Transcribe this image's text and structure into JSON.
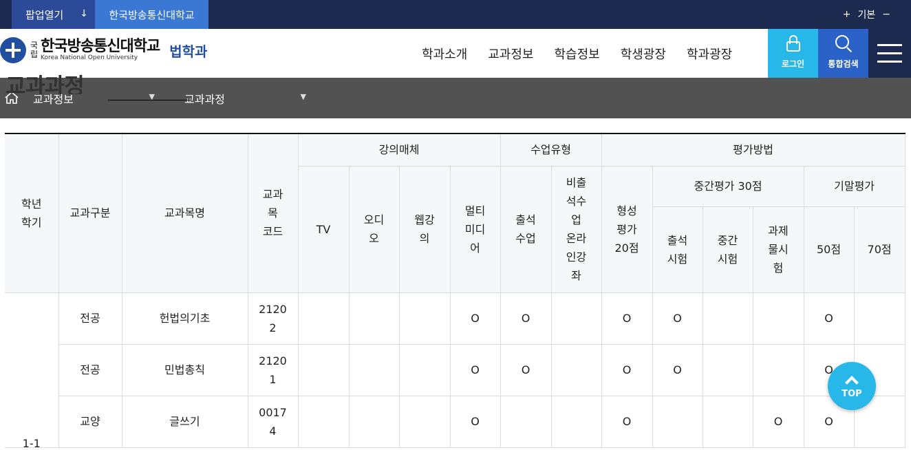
{
  "topbar": {
    "popup_label": "팝업열기",
    "popup_arrow": "↓",
    "univ_label": "한국방송통신대학교",
    "font_plus": "+",
    "font_label": "기본",
    "font_minus": "−"
  },
  "logo": {
    "national_top": "국",
    "national_bottom": "립",
    "name_kr": "한국방송통신대학교",
    "name_en": "Korea National Open University",
    "dept": "법학과"
  },
  "nav": {
    "items": [
      "학과소개",
      "교과정보",
      "학습정보",
      "학생광장",
      "학과광장"
    ]
  },
  "header_buttons": {
    "login": "로그인",
    "search": "통합검색"
  },
  "page_title": "교과과정",
  "breadcrumb": {
    "level1": "교과정보",
    "level2": "교과과정",
    "caret": "▼"
  },
  "table": {
    "headers": {
      "year_term": "학년\n학기",
      "category": "교과구분",
      "course_name": "교과목명",
      "course_code": "교과\n목\n코드",
      "media": "강의매체",
      "class_type": "수업유형",
      "evaluation": "평가방법",
      "tv": "TV",
      "audio": "오디\n오",
      "web": "웹강\n의",
      "multimedia": "멀티\n미디\n어",
      "attend_class": "출석\n수업",
      "online_lecture": "비출\n석수\n업\n온라\n인강\n좌",
      "formative": "형성\n평가\n20점",
      "midterm": "중간평가 30점",
      "final": "기말평가",
      "attend_exam": "출석\n시험",
      "mid_exam": "중간\n시험",
      "assignment": "과제\n물시\n험",
      "final_50": "50점",
      "final_70": "70점"
    },
    "year_term_value": "1-1",
    "rows": [
      {
        "category": "전공",
        "name": "헌법의기초",
        "code": "2120\n2",
        "tv": "",
        "audio": "",
        "web": "",
        "multi": "O",
        "attend": "O",
        "online": "",
        "formative": "O",
        "att_exam": "O",
        "mid_exam": "",
        "assign": "",
        "f50": "O",
        "f70": ""
      },
      {
        "category": "전공",
        "name": "민법총칙",
        "code": "2120\n1",
        "tv": "",
        "audio": "",
        "web": "",
        "multi": "O",
        "attend": "O",
        "online": "",
        "formative": "O",
        "att_exam": "O",
        "mid_exam": "",
        "assign": "",
        "f50": "O",
        "f70": ""
      },
      {
        "category": "교양",
        "name": "글쓰기",
        "code": "0017\n4",
        "tv": "",
        "audio": "",
        "web": "",
        "multi": "O",
        "attend": "",
        "online": "",
        "formative": "O",
        "att_exam": "",
        "mid_exam": "",
        "assign": "O",
        "f50": "O",
        "f70": ""
      }
    ]
  },
  "top_button": "TOP"
}
